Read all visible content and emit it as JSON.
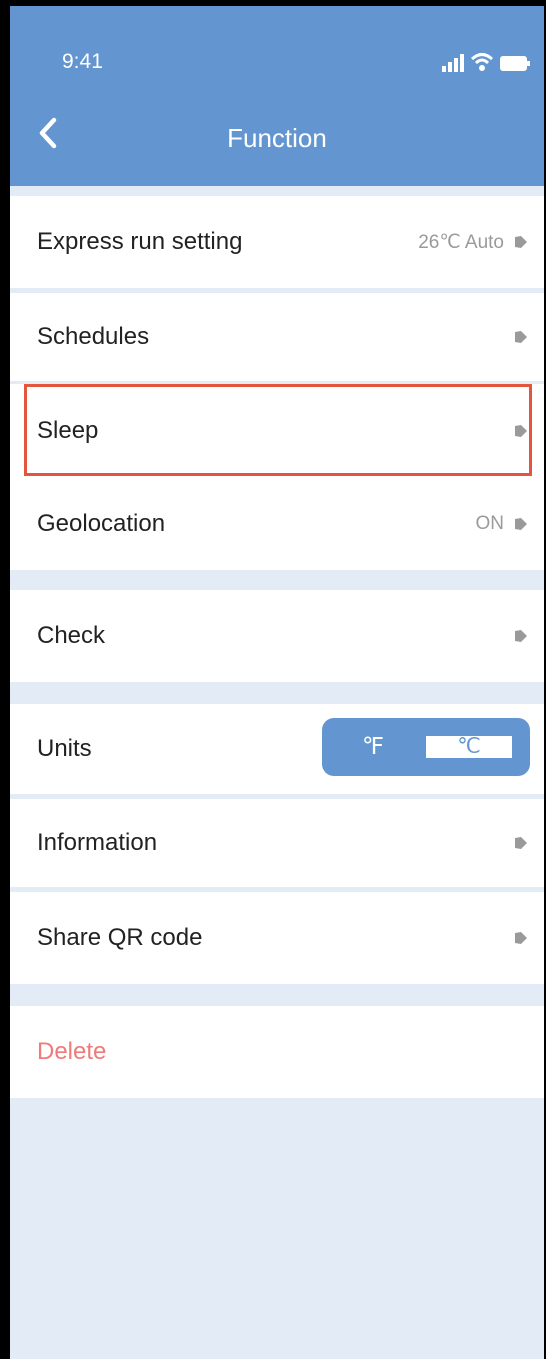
{
  "status_bar": {
    "time": "9:41"
  },
  "header": {
    "title": "Function"
  },
  "items": [
    {
      "label": "Express run setting",
      "value": "26℃ Auto"
    },
    {
      "label": "Schedules",
      "value": ""
    },
    {
      "label": "Sleep",
      "value": ""
    },
    {
      "label": "Geolocation",
      "value": "ON"
    },
    {
      "label": "Check",
      "value": ""
    },
    {
      "label": "Units",
      "value": ""
    },
    {
      "label": "Information",
      "value": ""
    },
    {
      "label": "Share QR code",
      "value": ""
    },
    {
      "label": "Delete",
      "value": ""
    }
  ],
  "units_toggle": {
    "fahrenheit": "℉",
    "celsius": "℃",
    "selected": "℃"
  },
  "highlighted_item": "Sleep",
  "colors": {
    "accent": "#6395d1",
    "background": "#e3ebf6",
    "highlight_border": "#e4553f",
    "delete": "#ef7a7a"
  }
}
